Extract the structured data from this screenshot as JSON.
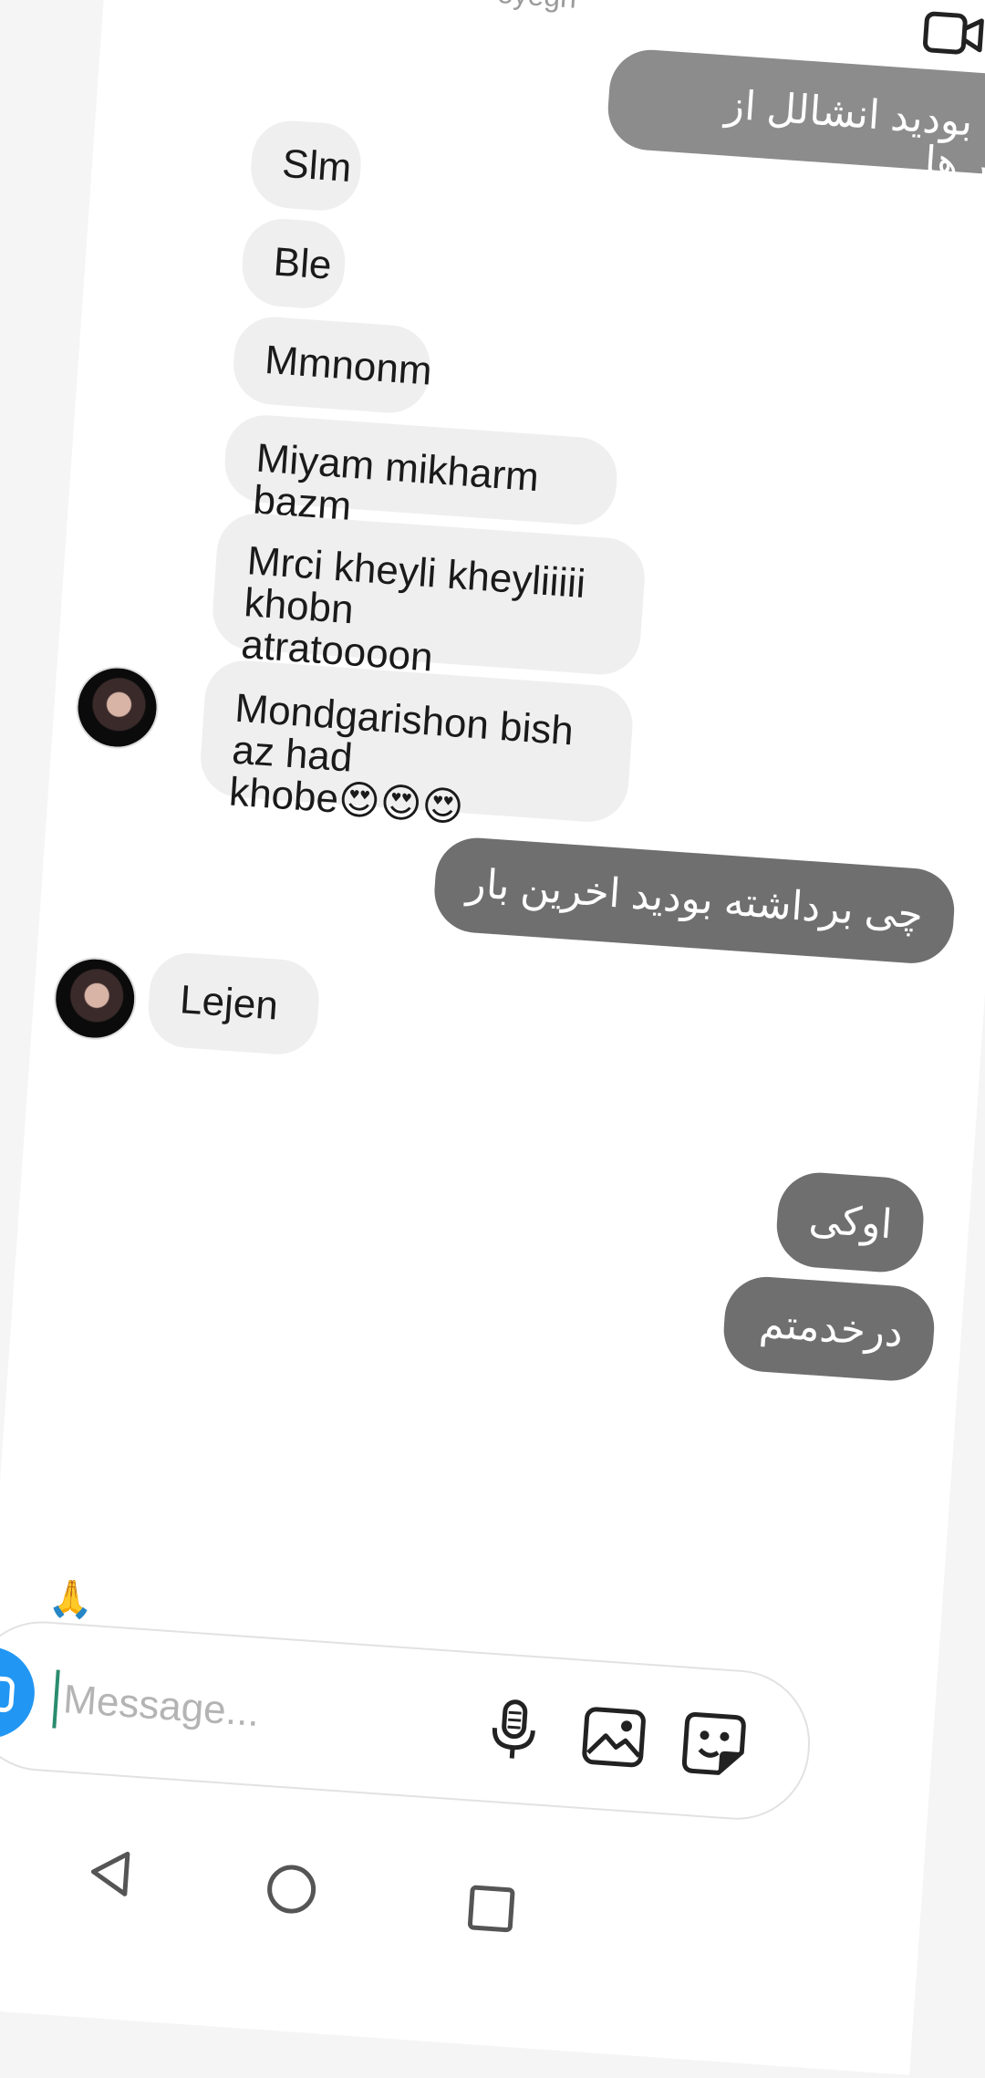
{
  "header": {
    "status_fragment": "eyegh"
  },
  "messages": [
    {
      "side": "out",
      "text": "ضی بودید انشالل از عطر ها"
    },
    {
      "side": "in",
      "text": "Slm"
    },
    {
      "side": "in",
      "text": "Ble"
    },
    {
      "side": "in",
      "text": "Mmnonm"
    },
    {
      "side": "in",
      "text": "Miyam mikharm  bazm"
    },
    {
      "side": "in",
      "text": "Mrci kheyli kheyliiiii khobn\natratoooon"
    },
    {
      "side": "in",
      "text": "Mondgarishon bish az had\nkhobe😍😍😍"
    },
    {
      "side": "out",
      "text": "چی برداشته بودید اخرین بار"
    },
    {
      "side": "in",
      "text": "Lejen"
    },
    {
      "side": "out",
      "text": "اوکی"
    },
    {
      "side": "out",
      "text": "درخدمتم"
    }
  ],
  "reaction_emoji": "🙏",
  "composer": {
    "placeholder": "Message..."
  },
  "icons": {
    "camera": "camera-icon",
    "mic": "microphone-icon",
    "gallery": "gallery-icon",
    "sticker": "sticker-icon",
    "video": "video-call-icon",
    "back": "nav-back-icon",
    "home": "nav-home-icon",
    "recents": "nav-recents-icon"
  },
  "colors": {
    "incoming_bubble": "#efefef",
    "outgoing_bubble": "#6f6f6f",
    "camera_button": "#2196f3",
    "cursor": "#2a8c6e"
  }
}
